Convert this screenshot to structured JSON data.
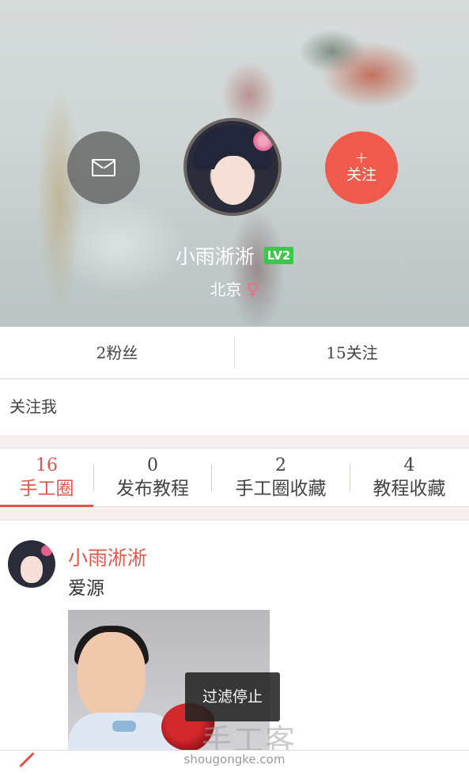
{
  "profile": {
    "name": "小雨淅淅",
    "level_badge": "LV2",
    "location": "北京",
    "gender_symbol": "♀",
    "follow_plus": "+",
    "follow_label": "关注",
    "message_icon": "envelope-icon"
  },
  "stats": {
    "fans": "2粉丝",
    "following": "15关注"
  },
  "bio": "关注我",
  "tabs": [
    {
      "count": "16",
      "label": "手工圈",
      "active": true
    },
    {
      "count": "0",
      "label": "发布教程",
      "active": false
    },
    {
      "count": "2",
      "label": "手工圈收藏",
      "active": false
    },
    {
      "count": "4",
      "label": "教程收藏",
      "active": false
    }
  ],
  "post": {
    "author": "小雨淅淅",
    "text": "爱源"
  },
  "toast": "过滤停止",
  "watermark": {
    "cn": "手工客",
    "url": "shougongke.com"
  },
  "colors": {
    "accent": "#e0564a",
    "follow_button": "#ef5a4c",
    "level_badge": "#3ec64a",
    "gender": "#ec6d8e"
  }
}
